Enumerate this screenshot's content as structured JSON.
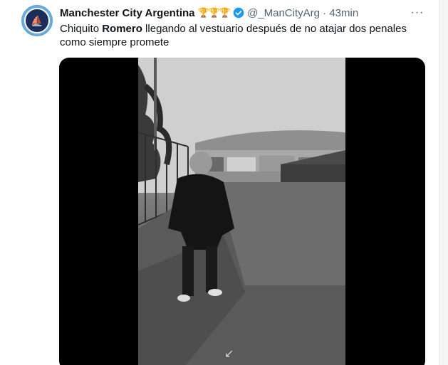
{
  "tweet": {
    "author_name": "Manchester City Argentina",
    "trophies": "🏆🏆🏆",
    "handle_time": "@_ManCityArg · 43min",
    "text_before": "Chiquito ",
    "text_bold": "Romero",
    "text_after": " llegando al vestuario después de no atajar dos penales como siempre promete",
    "avatar_icon": "manchester-city-crest",
    "more_icon": "more-options-icon"
  },
  "colors": {
    "accent": "#1d9bf0",
    "name": "#0f1419",
    "muted": "#536471",
    "trophy": "#d4a017"
  }
}
